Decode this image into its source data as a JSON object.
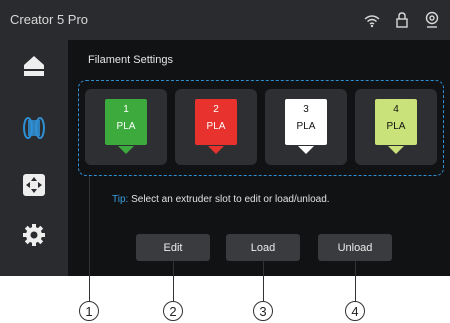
{
  "app": {
    "title": "Creator 5 Pro"
  },
  "status_icons": [
    "wifi-icon",
    "lock-icon",
    "camera-icon"
  ],
  "sidebar": {
    "items": [
      {
        "name": "home-icon"
      },
      {
        "name": "filament-icon",
        "active": true
      },
      {
        "name": "move-icon"
      },
      {
        "name": "settings-icon"
      }
    ]
  },
  "main": {
    "title": "Filament Settings",
    "slots": [
      {
        "number": "1",
        "material": "PLA",
        "color": "#3daa3d",
        "text_color": "#ffffff",
        "arrow_color": "#3daa3d"
      },
      {
        "number": "2",
        "material": "PLA",
        "color": "#e8322d",
        "text_color": "#ffffff",
        "arrow_color": "#e8322d"
      },
      {
        "number": "3",
        "material": "PLA",
        "color": "#ffffff",
        "text_color": "#111111",
        "arrow_color": "#ffffff"
      },
      {
        "number": "4",
        "material": "PLA",
        "color": "#c9e27a",
        "text_color": "#111111",
        "arrow_color": "#c9e27a"
      }
    ],
    "tip": {
      "label": "Tip:",
      "text": "Select an extruder slot to edit or load/unload."
    },
    "buttons": {
      "edit": "Edit",
      "load": "Load",
      "unload": "Unload"
    }
  },
  "callouts": [
    "1",
    "2",
    "3",
    "4"
  ],
  "colors": {
    "accent": "#2f8fd3",
    "active_icon": "#2f8fd3"
  }
}
